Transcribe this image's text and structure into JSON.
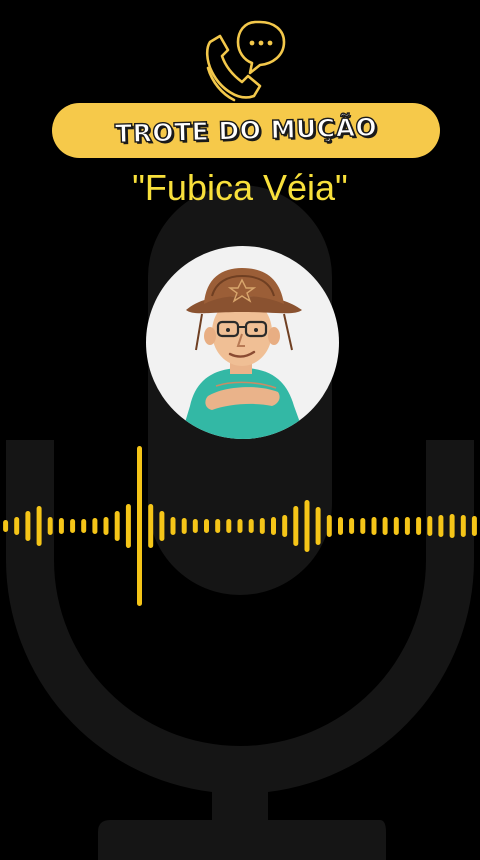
{
  "header": {
    "title": "TROTE DO MUÇÃO",
    "subtitle": "\"Fubica Véia\""
  },
  "icons": {
    "call": "phone-chat-icon",
    "background": "microphone-icon",
    "waveform": "audio-waveform-icon"
  },
  "colors": {
    "background": "#000000",
    "accent": "#f6c94a",
    "subtitle": "#f8e03b",
    "wave": "#f5c518"
  }
}
